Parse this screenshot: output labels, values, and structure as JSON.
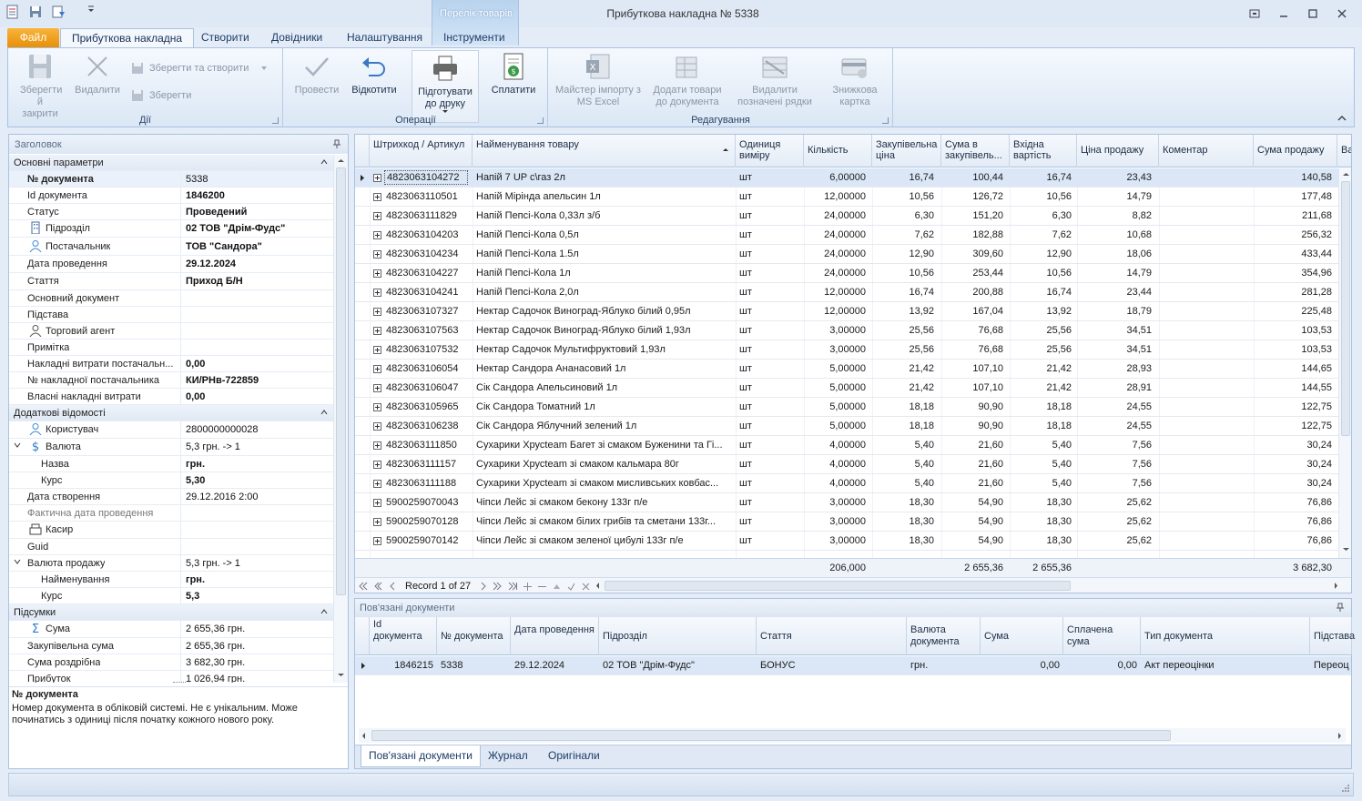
{
  "window": {
    "title": "Прибуткова накладна № 5338",
    "context_tab": "Перелік товарів"
  },
  "tabs": {
    "file": "Файл",
    "items": [
      "Прибуткова накладна",
      "Створити",
      "Довідники",
      "Налаштування",
      "Інструменти"
    ]
  },
  "ribbon": {
    "save_close": "Зберегти й закрити",
    "delete": "Видалити",
    "save_create": "Зберегти та створити",
    "save": "Зберегти",
    "group_actions": "Дії",
    "post": "Провести",
    "undo": "Відкотити",
    "print": "Підготувати до друку",
    "pay": "Сплатити",
    "group_operations": "Операції",
    "import_excel": "Майстер імпорту з MS Excel",
    "add_goods": "Додати товари до документа",
    "delete_marked": "Видалити позначені рядки",
    "discount_card": "Знижкова картка",
    "group_edit": "Редагування"
  },
  "header_panel": {
    "title": "Заголовок",
    "cat_main": "Основні параметри",
    "doc_number_label": "№ документа",
    "doc_number": "5338",
    "doc_id_label": "Id документа",
    "doc_id": "1846200",
    "status_label": "Статус",
    "status": "Проведений",
    "division_label": "Підрозділ",
    "division": "02 ТОВ \"Дрім-Фудс\"",
    "supplier_label": "Постачальник",
    "supplier": "ТОВ \"Сандора\"",
    "post_date_label": "Дата проведення",
    "post_date": "29.12.2024",
    "article_label": "Стаття",
    "article": "Приход Б/Н",
    "main_doc_label": "Основний документ",
    "basis_label": "Підстава",
    "agent_label": "Торговий агент",
    "note_label": "Примітка",
    "overhead_label": "Накладні витрати постачальн...",
    "overhead": "0,00",
    "supplier_inv_label": "№ накладної постачальника",
    "supplier_inv": "КИ/РНв-722859",
    "own_overhead_label": "Власні накладні витрати",
    "own_overhead": "0,00",
    "cat_extra": "Додаткові відомості",
    "user_label": "Користувач",
    "user": "2800000000028",
    "currency_label": "Валюта",
    "currency": "5,3 грн. -> 1",
    "cur_name_label": "Назва",
    "cur_name": "грн.",
    "cur_rate_label": "Курс",
    "cur_rate": "5,30",
    "created_label": "Дата створення",
    "created": "29.12.2016 2:00",
    "actual_date_label": "Фактична дата проведення",
    "cashier_label": "Касир",
    "guid_label": "Guid",
    "sale_cur_label": "Валюта продажу",
    "sale_cur": "5,3 грн. -> 1",
    "sale_cur_name_label": "Найменування",
    "sale_cur_name": "грн.",
    "sale_cur_rate_label": "Курс",
    "sale_cur_rate": "5,3",
    "cat_totals": "Підсумки",
    "sum_label": "Сума",
    "sum": "2 655,36 грн.",
    "purchase_sum_label": "Закупівельна сума",
    "purchase_sum": "2 655,36 грн.",
    "retail_sum_label": "Сума роздрібна",
    "retail_sum": "3 682,30 грн.",
    "profit_label": "Прибуток",
    "profit": "1 026,94 грн.",
    "desc_title": "№ документа",
    "desc_text": "Номер документа в обліковій системі. Не є унікальним. Може починатись з одиниці після початку кожного нового року."
  },
  "grid": {
    "headers": [
      "Штрихкод / Артикул",
      "Найменування товару",
      "Одиниця виміру",
      "Кількість",
      "Закупівельна ціна",
      "Сума в закупівель...",
      "Вхідна вартість",
      "Ціна продажу",
      "Коментар",
      "Сума продажу",
      "Ва"
    ],
    "rows": [
      [
        "4823063104272",
        "Напій 7 UP с\\газ 2л",
        "шт",
        "6,00000",
        "16,74",
        "100,44",
        "16,74",
        "23,43",
        "",
        "140,58"
      ],
      [
        "4823063110501",
        "Напій Мірінда апельсин 1л",
        "шт",
        "12,00000",
        "10,56",
        "126,72",
        "10,56",
        "14,79",
        "",
        "177,48"
      ],
      [
        "4823063111829",
        "Напій Пепсі-Кола 0,33л з/б",
        "шт",
        "24,00000",
        "6,30",
        "151,20",
        "6,30",
        "8,82",
        "",
        "211,68"
      ],
      [
        "4823063104203",
        "Напій Пепсі-Кола 0,5л",
        "шт",
        "24,00000",
        "7,62",
        "182,88",
        "7,62",
        "10,68",
        "",
        "256,32"
      ],
      [
        "4823063104234",
        "Напій Пепсі-Кола 1.5л",
        "шт",
        "24,00000",
        "12,90",
        "309,60",
        "12,90",
        "18,06",
        "",
        "433,44"
      ],
      [
        "4823063104227",
        "Напій Пепсі-Кола 1л",
        "шт",
        "24,00000",
        "10,56",
        "253,44",
        "10,56",
        "14,79",
        "",
        "354,96"
      ],
      [
        "4823063104241",
        "Напій Пепсі-Кола 2,0л",
        "шт",
        "12,00000",
        "16,74",
        "200,88",
        "16,74",
        "23,44",
        "",
        "281,28"
      ],
      [
        "4823063107327",
        "Нектар Садочок Виноград-Яблуко білий 0,95л",
        "шт",
        "12,00000",
        "13,92",
        "167,04",
        "13,92",
        "18,79",
        "",
        "225,48"
      ],
      [
        "4823063107563",
        "Нектар Садочок Виноград-Яблуко білий 1,93л",
        "шт",
        "3,00000",
        "25,56",
        "76,68",
        "25,56",
        "34,51",
        "",
        "103,53"
      ],
      [
        "4823063107532",
        "Нектар Садочок Мультифруктовий 1,93л",
        "шт",
        "3,00000",
        "25,56",
        "76,68",
        "25,56",
        "34,51",
        "",
        "103,53"
      ],
      [
        "4823063106054",
        "Нектар Сандора Ананасовий 1л",
        "шт",
        "5,00000",
        "21,42",
        "107,10",
        "21,42",
        "28,93",
        "",
        "144,65"
      ],
      [
        "4823063106047",
        "Сік Сандора Апельсиновий 1л",
        "шт",
        "5,00000",
        "21,42",
        "107,10",
        "21,42",
        "28,91",
        "",
        "144,55"
      ],
      [
        "4823063105965",
        "Сік Сандора Томатний 1л",
        "шт",
        "5,00000",
        "18,18",
        "90,90",
        "18,18",
        "24,55",
        "",
        "122,75"
      ],
      [
        "4823063106238",
        "Сік Сандора Яблучний зелений 1л",
        "шт",
        "5,00000",
        "18,18",
        "90,90",
        "18,18",
        "24,55",
        "",
        "122,75"
      ],
      [
        "4823063111850",
        "Сухарики Хрусteam Багет зі смаком Буженини та Гі...",
        "шт",
        "4,00000",
        "5,40",
        "21,60",
        "5,40",
        "7,56",
        "",
        "30,24"
      ],
      [
        "4823063111157",
        "Сухарики Хрусteam зі смаком кальмара 80г",
        "шт",
        "4,00000",
        "5,40",
        "21,60",
        "5,40",
        "7,56",
        "",
        "30,24"
      ],
      [
        "4823063111188",
        "Сухарики Хрусteam зі смаком мисливських ковбас...",
        "шт",
        "4,00000",
        "5,40",
        "21,60",
        "5,40",
        "7,56",
        "",
        "30,24"
      ],
      [
        "5900259070043",
        "Чіпси Лейс зі смаком бекону 133г п/е",
        "шт",
        "3,00000",
        "18,30",
        "54,90",
        "18,30",
        "25,62",
        "",
        "76,86"
      ],
      [
        "5900259070128",
        "Чіпси Лейс зі смаком білих грибів та сметани 133г...",
        "шт",
        "3,00000",
        "18,30",
        "54,90",
        "18,30",
        "25,62",
        "",
        "76,86"
      ],
      [
        "5900259070142",
        "Чіпси Лейс зі смаком зеленої цибулі 133г п/е",
        "шт",
        "3,00000",
        "18,30",
        "54,90",
        "18,30",
        "25,62",
        "",
        "76,86"
      ]
    ],
    "totals": {
      "qty": "206,000",
      "sum": "2 655,36",
      "incoming": "2 655,36",
      "sale_sum": "3 682,30"
    },
    "record_text": "Record 1 of 27"
  },
  "related": {
    "title": "Пов'язані документи",
    "headers": [
      "Id документа",
      "№ документа",
      "Дата проведення",
      "Підрозділ",
      "Стаття",
      "Валюта документа",
      "Сума",
      "Сплачена сума",
      "Тип документа",
      "Підстава"
    ],
    "row": [
      "1846215",
      "5338",
      "29.12.2024",
      "02 ТОВ \"Дрім-Фудс\"",
      "БОНУС",
      "грн.",
      "0,00",
      "0,00",
      "Акт переоцінки",
      "Переоц"
    ],
    "tabs": [
      "Пов'язані документи",
      "Журнал",
      "Оригінали"
    ]
  }
}
